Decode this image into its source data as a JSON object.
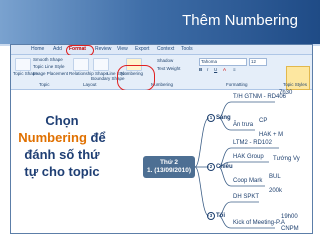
{
  "slide": {
    "title": "Thêm Numbering",
    "caption_lines": [
      "Chọn",
      "Numbering để",
      "đánh số thứ",
      "tự cho topic"
    ],
    "caption_highlight": "Numbering",
    "colors": {
      "title_bg_dark": "#1f4b86",
      "caption": "#1f3f74",
      "highlight": "#e07000"
    }
  },
  "ribbon": {
    "tabs": [
      "Home",
      "Add",
      "Format",
      "Review",
      "View",
      "Export",
      "Context",
      "Tools"
    ],
    "active_tab": "Format",
    "groups": {
      "topic": {
        "items": [
          "Topic Shape",
          "Smooth Shape",
          "Topic Line Style",
          "Image Placement"
        ],
        "label": "Topic"
      },
      "layout": {
        "items": [
          "Relationship Shape",
          "Boundary Shape",
          "Line Style"
        ],
        "label": "Layout"
      },
      "numbering": {
        "label": "Numbering",
        "items": [
          "Numbering",
          "Shadow",
          "Text Weight"
        ]
      },
      "font": {
        "font_name": "Tahoma",
        "font_size": "12",
        "label": "Formatting"
      },
      "styles": {
        "label": "Topic Styles",
        "item": "Topic Styles"
      }
    }
  },
  "mindmap": {
    "central": {
      "line1": "Thứ 2",
      "line2": "(13/09/2010)",
      "num": "1"
    },
    "branches": [
      {
        "num": "1",
        "label": "Sáng",
        "children": [
          "T/H GTNM - RD406",
          "Ăn trưa"
        ],
        "grandchildren": [
          "7h30",
          "CP",
          "HAK + M"
        ]
      },
      {
        "num": "2",
        "label": "Chiều",
        "children": [
          "LTM2 - RD102",
          "HAK Group",
          "Coop Mark"
        ],
        "grandchildren": [
          "Tướng Vy",
          "BUL",
          "200k"
        ]
      },
      {
        "num": "3",
        "label": "Tối",
        "children": [
          "DH SPKT",
          "Kick of Meeting-P.A"
        ],
        "grandchildren": [
          "19h00",
          "CNPM"
        ]
      }
    ]
  }
}
